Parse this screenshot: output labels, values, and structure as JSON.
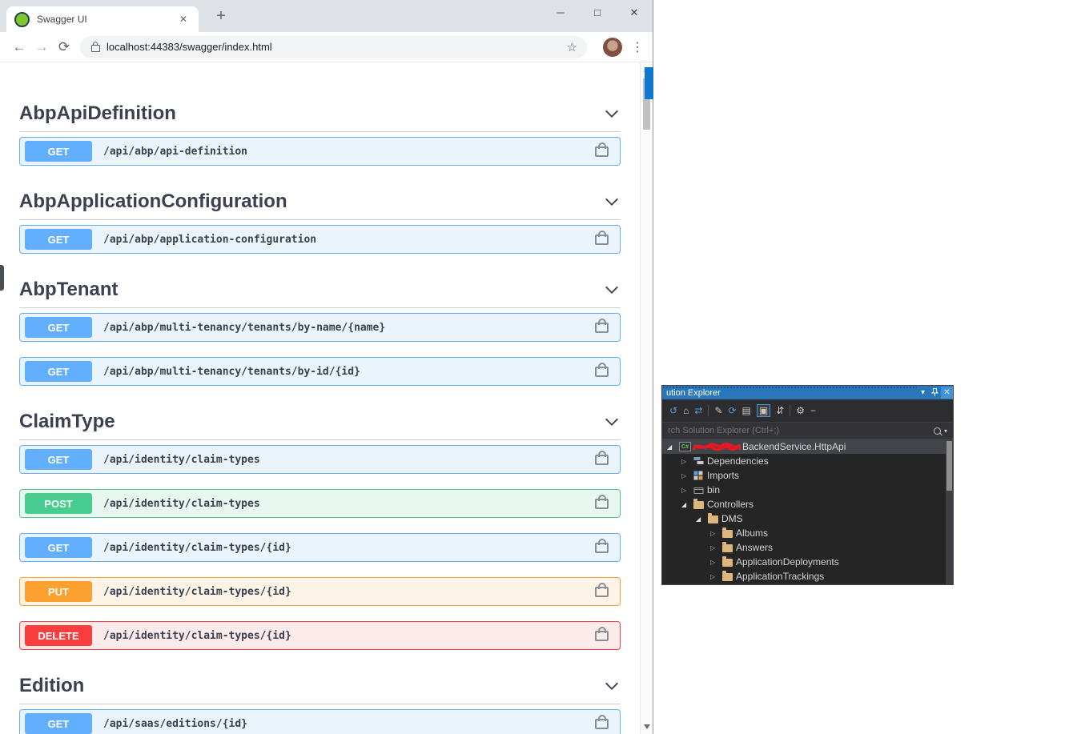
{
  "browser": {
    "tab_title": "Swagger UI",
    "url": "localhost:44383/swagger/index.html"
  },
  "icons": {
    "back": "←",
    "forward": "→",
    "reload": "⟳",
    "star": "☆",
    "menu": "⋮",
    "new_tab": "+",
    "tab_close": "✕",
    "minimize": "─",
    "maximize": "□",
    "close": "✕",
    "window_position": "▾",
    "panel_close": "✕",
    "expander_collapsed": "▷",
    "expander_expanded": "◢",
    "csharp": "C#",
    "search_dropdown": "▾"
  },
  "swagger": {
    "method_colors": {
      "GET": "#61affe",
      "POST": "#49cc90",
      "PUT": "#fca130",
      "DELETE": "#f93e3e"
    },
    "sections": [
      {
        "title": "AbpApiDefinition",
        "operations": [
          {
            "method": "GET",
            "path": "/api/abp/api-definition"
          }
        ]
      },
      {
        "title": "AbpApplicationConfiguration",
        "operations": [
          {
            "method": "GET",
            "path": "/api/abp/application-configuration"
          }
        ]
      },
      {
        "title": "AbpTenant",
        "operations": [
          {
            "method": "GET",
            "path": "/api/abp/multi-tenancy/tenants/by-name/{name}"
          },
          {
            "method": "GET",
            "path": "/api/abp/multi-tenancy/tenants/by-id/{id}"
          }
        ]
      },
      {
        "title": "ClaimType",
        "operations": [
          {
            "method": "GET",
            "path": "/api/identity/claim-types"
          },
          {
            "method": "POST",
            "path": "/api/identity/claim-types"
          },
          {
            "method": "GET",
            "path": "/api/identity/claim-types/{id}"
          },
          {
            "method": "PUT",
            "path": "/api/identity/claim-types/{id}"
          },
          {
            "method": "DELETE",
            "path": "/api/identity/claim-types/{id}"
          }
        ]
      },
      {
        "title": "Edition",
        "operations": [
          {
            "method": "GET",
            "path": "/api/saas/editions/{id}"
          }
        ]
      }
    ]
  },
  "solution_explorer": {
    "title": "ution Explorer",
    "search_placeholder": "rch Solution Explorer (Ctrl+;)",
    "toolbar": [
      {
        "name": "back",
        "glyph": "↺"
      },
      {
        "name": "home",
        "glyph": "⌂"
      },
      {
        "name": "sync-with-active-document",
        "glyph": "⇄"
      },
      {
        "name": "edit-filter",
        "glyph": "✎"
      },
      {
        "name": "refresh",
        "glyph": "⟳"
      },
      {
        "name": "collapse-all",
        "glyph": "▤"
      },
      {
        "name": "show-all-files",
        "glyph": "▣"
      },
      {
        "name": "nest-files",
        "glyph": "⇵"
      },
      {
        "name": "properties",
        "glyph": "⚙"
      },
      {
        "name": "preview",
        "glyph": "−"
      }
    ],
    "tree": [
      {
        "label": "BackendService.HttpApi",
        "selected": true
      },
      {
        "label": "Dependencies"
      },
      {
        "label": "Imports"
      },
      {
        "label": "bin"
      },
      {
        "label": "Controllers"
      },
      {
        "label": "DMS"
      },
      {
        "label": "Albums"
      },
      {
        "label": "Answers"
      },
      {
        "label": "ApplicationDeployments"
      },
      {
        "label": "ApplicationTrackings"
      }
    ]
  }
}
